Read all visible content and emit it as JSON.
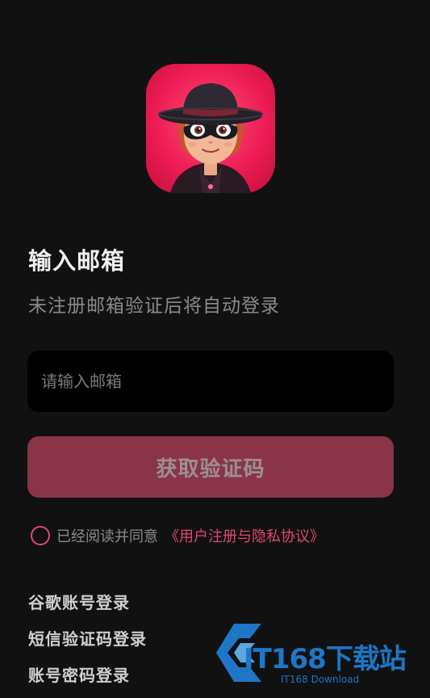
{
  "app_icon": {
    "name": "masked-character-avatar-icon"
  },
  "page": {
    "title": "输入邮箱",
    "subtitle": "未注册邮箱验证后将自动登录"
  },
  "email": {
    "placeholder": "请输入邮箱",
    "value": ""
  },
  "get_code_button": {
    "label": "获取验证码"
  },
  "agreement": {
    "checked": false,
    "text": "已经阅读并同意",
    "link": "《用户注册与隐私协议》"
  },
  "alt_login": {
    "google": "谷歌账号登录",
    "sms": "短信验证码登录",
    "account": "账号密码登录"
  },
  "watermark": {
    "main": "IT168下载站",
    "sub": "IT168 Download"
  },
  "colors": {
    "background": "#111112",
    "accent": "#e3486f",
    "button": "#8a3449",
    "input_bg": "#000000"
  }
}
